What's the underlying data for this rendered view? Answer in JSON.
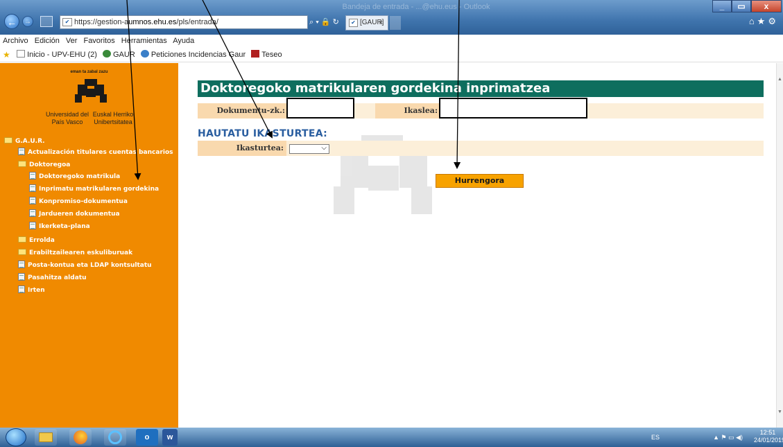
{
  "browser": {
    "url_prefix": "https://gestion-a",
    "url_host": "umnos.ehu.es",
    "url_path": "/pls/entrada/",
    "addr_icons": "⌕ ▾ 🔒 ↻",
    "tab_label": "[GAUR]",
    "tab_close": "×",
    "title_ghost": "Bandeja de entrada - ...@ehu.eus - Outlook",
    "win_min": "_",
    "win_max": "▭",
    "win_close": "x",
    "right_icons": "⌂★⚙"
  },
  "menubar": [
    "Archivo",
    "Edición",
    "Ver",
    "Favoritos",
    "Herramientas",
    "Ayuda"
  ],
  "favorites": [
    {
      "label": "Inicio - UPV-EHU (2)",
      "color": "#1a5da8"
    },
    {
      "label": "GAUR",
      "color": "#3a8a3a"
    },
    {
      "label": "Peticiones Incidencias Gaur",
      "color": "#3a7fc8"
    },
    {
      "label": "Teseo",
      "color": "#b02020"
    }
  ],
  "sidebar": {
    "motto": "eman ta zabal zazu",
    "uni_es": "Universidad del País Vasco",
    "uni_eu": "Euskal Herriko Unibertsitatea",
    "items": [
      {
        "label": "G.A.U.R.",
        "icon": "folder-icon"
      },
      {
        "label": "Actualización titulares cuentas bancarios",
        "icon": "document-icon"
      },
      {
        "label": "Doktoregoa",
        "icon": "folder-icon"
      },
      {
        "label": "Doktoregoko matrikula",
        "icon": "document-icon"
      },
      {
        "label": "Inprimatu matrikularen gordekina",
        "icon": "document-icon"
      },
      {
        "label": "Konpromiso-dokumentua",
        "icon": "document-icon"
      },
      {
        "label": "Jardueren dokumentua",
        "icon": "document-icon"
      },
      {
        "label": "Ikerketa-plana",
        "icon": "document-icon"
      },
      {
        "label": "Errolda",
        "icon": "folder-icon"
      },
      {
        "label": "Erabiltzailearen eskuliburuak",
        "icon": "folder-icon"
      },
      {
        "label": "Posta-kontua eta LDAP kontsultatu",
        "icon": "document-icon"
      },
      {
        "label": "Pasahitza aldatu",
        "icon": "document-icon"
      },
      {
        "label": "Irten",
        "icon": "document-icon"
      }
    ]
  },
  "main": {
    "title": "Doktoregoko matrikularen gordekina inprimatzea",
    "dokumentu_label": "Dokumentu-zk.:",
    "dokumentu_value": "",
    "ikaslea_label": "Ikaslea:",
    "ikaslea_value": "",
    "section_title": "HAUTATU IKASTURTEA:",
    "ikasturtea_label": "Ikasturtea:",
    "ikasturtea_value": "",
    "next_button": "Hurrengora"
  },
  "taskbar": {
    "apps": [
      "ie-icon",
      "explorer-icon",
      "firefox-icon",
      "ie-icon",
      "outlook-icon",
      "word-icon"
    ],
    "outlook_letter": "o",
    "word_letter": "w",
    "lang": "ES",
    "tray_icons": "▲ ⚑ ▭ ◀)",
    "time": "12:51",
    "date": "24/01/2019"
  }
}
